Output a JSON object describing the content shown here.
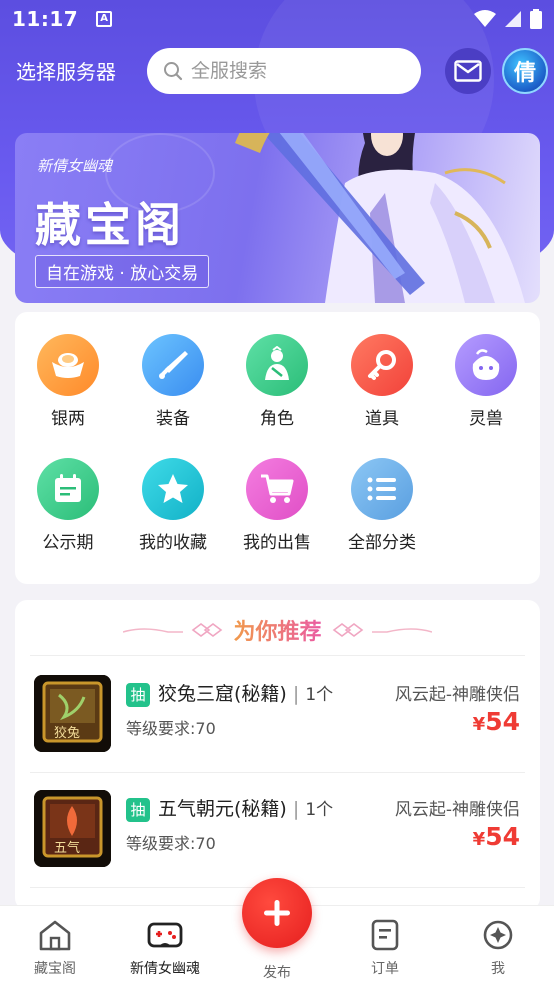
{
  "status_bar": {
    "time": "11:17",
    "notif_glyph": "A"
  },
  "header": {
    "server_select": "选择服务器",
    "search_placeholder": "全服搜索",
    "mail_icon": "mail-icon",
    "game_avatar_glyph": "倩"
  },
  "banner": {
    "game_logo": "新倩女幽魂",
    "title": "藏宝阁",
    "slogan": "自在游戏 · 放心交易"
  },
  "categories": [
    {
      "label": "银两",
      "icon": "silver-ingot-icon",
      "color": "#ffa23b"
    },
    {
      "label": "装备",
      "icon": "sword-icon",
      "color": "#4aa8f5"
    },
    {
      "label": "角色",
      "icon": "character-icon",
      "color": "#3ccf8e"
    },
    {
      "label": "道具",
      "icon": "key-icon",
      "color": "#f8574a"
    },
    {
      "label": "灵兽",
      "icon": "pet-icon",
      "color": "#9a7df5"
    },
    {
      "label": "公示期",
      "icon": "calendar-icon",
      "color": "#3ccf8e"
    },
    {
      "label": "我的收藏",
      "icon": "star-icon",
      "color": "#1ec5d6"
    },
    {
      "label": "我的出售",
      "icon": "cart-icon",
      "color": "#ec5bd0"
    },
    {
      "label": "全部分类",
      "icon": "list-icon",
      "color": "#5fa6e6"
    }
  ],
  "recommend": {
    "title": "为你推荐",
    "items": [
      {
        "tag": "抽",
        "name": "狡兔三窟(秘籍)",
        "quantity": "1个",
        "level": "等级要求:70",
        "server": "风云起-神雕侠侣",
        "currency": "¥",
        "price": "54",
        "thumb_text": "狡兔"
      },
      {
        "tag": "抽",
        "name": "五气朝元(秘籍)",
        "quantity": "1个",
        "level": "等级要求:70",
        "server": "风云起-神雕侠侣",
        "currency": "¥",
        "price": "54",
        "thumb_text": "五气"
      }
    ]
  },
  "bottom_nav": {
    "items": [
      {
        "label": "藏宝阁",
        "icon": "home-icon"
      },
      {
        "label": "新倩女幽魂",
        "icon": "gamepad-icon"
      },
      {
        "label": "发布",
        "icon": "plus-icon"
      },
      {
        "label": "订单",
        "icon": "order-icon"
      },
      {
        "label": "我",
        "icon": "profile-icon"
      }
    ]
  },
  "colors": {
    "primary": "#6a5bf0",
    "price": "#ef3b34",
    "tag": "#23c28b",
    "publish": "#e51e1e"
  }
}
